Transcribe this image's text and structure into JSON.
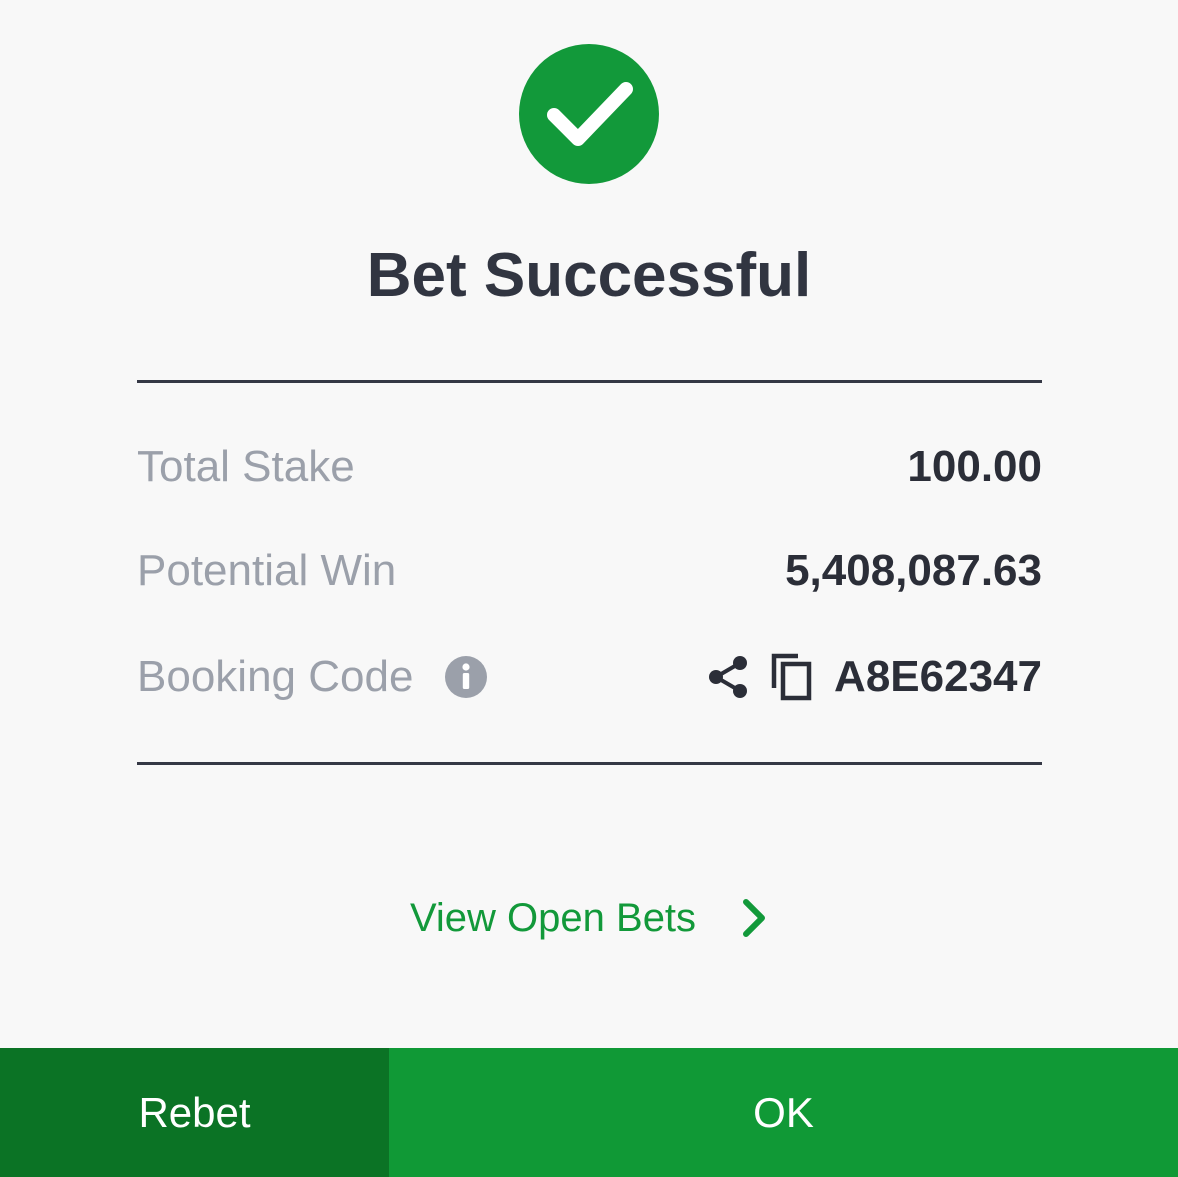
{
  "title": "Bet Successful",
  "details": {
    "total_stake": {
      "label": "Total Stake",
      "value": "100.00"
    },
    "potential_win": {
      "label": "Potential Win",
      "value": "5,408,087.63"
    },
    "booking_code": {
      "label": "Booking Code",
      "value": "A8E62347"
    }
  },
  "icons": {
    "success": "checkmark-circle-icon",
    "info": "info-icon",
    "share": "share-icon",
    "copy": "copy-icon",
    "chevron": "chevron-right-icon"
  },
  "links": {
    "view_open_bets": "View Open Bets"
  },
  "buttons": {
    "rebet": "Rebet",
    "ok": "OK"
  },
  "colors": {
    "accent_green": "#12993a",
    "rebet_bg": "#0b7325",
    "ok_bg": "#109936",
    "title_text": "#313541",
    "label_text": "#9ba0aa"
  }
}
